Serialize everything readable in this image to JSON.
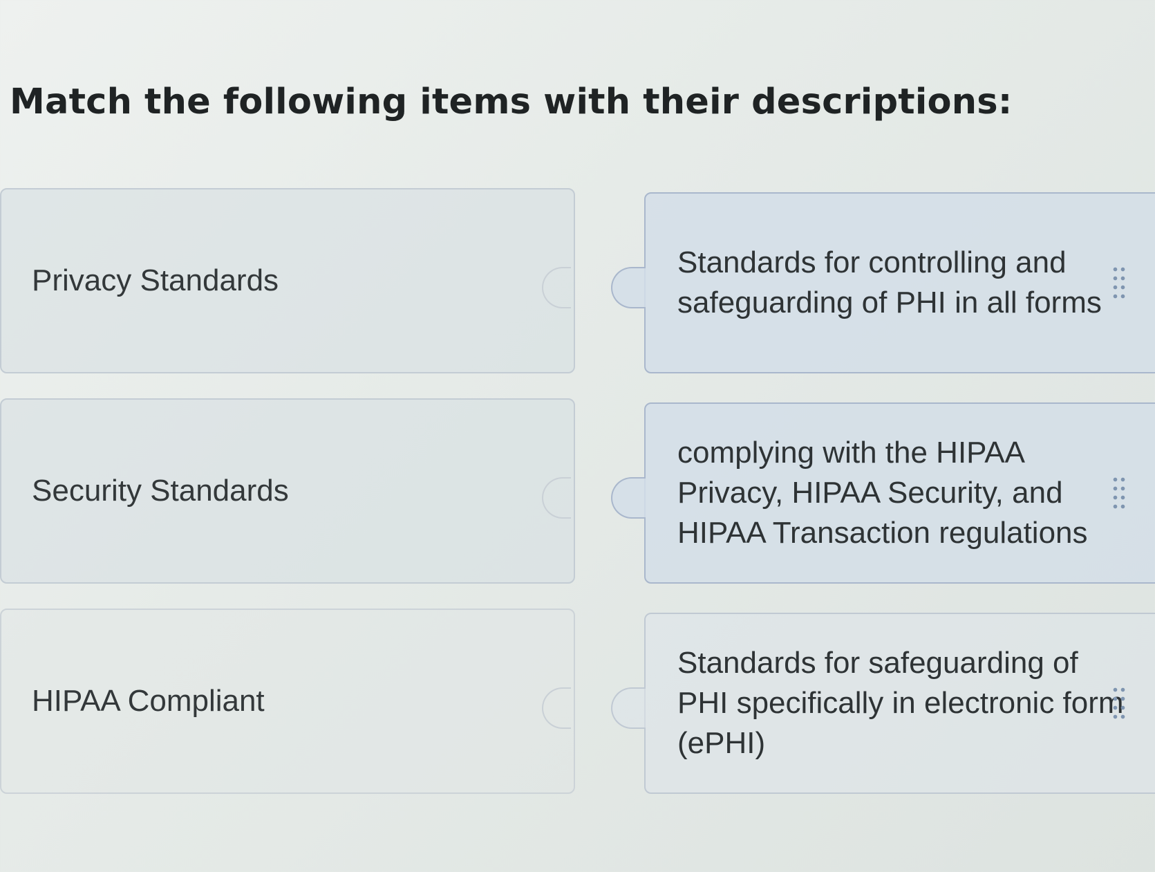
{
  "question": {
    "title": "Match the following items with their descriptions:"
  },
  "pairs": [
    {
      "item": "Privacy Standards",
      "description": "Standards for controlling and safeguarding of PHI in all forms"
    },
    {
      "item": "Security Standards",
      "description": "complying with the HIPAA Privacy, HIPAA Security, and HIPAA Transaction regulations"
    },
    {
      "item": "HIPAA Compliant",
      "description": "Standards for safeguarding of PHI specifically in electronic form (ePHI)"
    }
  ],
  "icons": {
    "drag_handle": "drag-handle-icon"
  },
  "colors": {
    "left_card_border": "#c3ccd4",
    "right_card_border": "#a9b7cc",
    "right_card_fill": "#d3dee7",
    "handle_dots": "#7f95b0"
  }
}
